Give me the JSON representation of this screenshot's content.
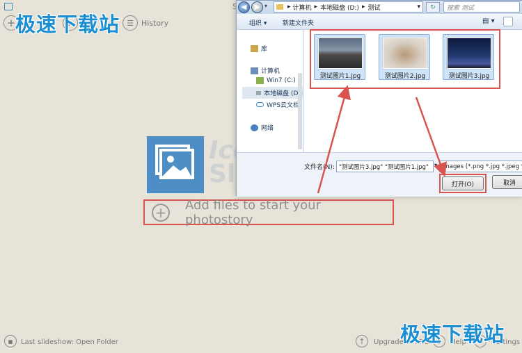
{
  "app": {
    "history_label": "History",
    "logo_text_line1": "Ice",
    "logo_text_line2": "Sli",
    "add_files_label": "Add files to start your photostory",
    "last_slideshow_label": "Last slideshow: Open Folder",
    "upgrade_label": "Upgrade to PRO",
    "help_label": "Help",
    "settings_label": "Settings",
    "title_fragment": "S"
  },
  "watermark": {
    "top": "极速下载站",
    "bottom": "极速下载站"
  },
  "dialog": {
    "breadcrumb": [
      "计算机",
      "本地磁盘 (D:)",
      "测试"
    ],
    "search_placeholder": "搜索 测试",
    "organize_label": "组织 ▾",
    "new_folder_label": "新建文件夹",
    "nav": {
      "library": "库",
      "computer": "计算机",
      "win7": "Win7 (C:)",
      "local_disk": "本地磁盘 (D:)",
      "wps": "WPS云文档",
      "network": "网络"
    },
    "files": [
      {
        "name": "测试图片1.jpg"
      },
      {
        "name": "测试图片2.jpg"
      },
      {
        "name": "测试图片3.jpg"
      }
    ],
    "filename_label": "文件名(N):",
    "filename_value": "\"测试图片3.jpg\" \"测试图片1.jpg\"",
    "filetype_value": "Images (*.png *.jpg *.jpeg *",
    "open_label": "打开(O)",
    "cancel_label": "取消"
  },
  "colors": {
    "accent_red": "#d9534f",
    "brand_blue": "#1a8ed1"
  }
}
